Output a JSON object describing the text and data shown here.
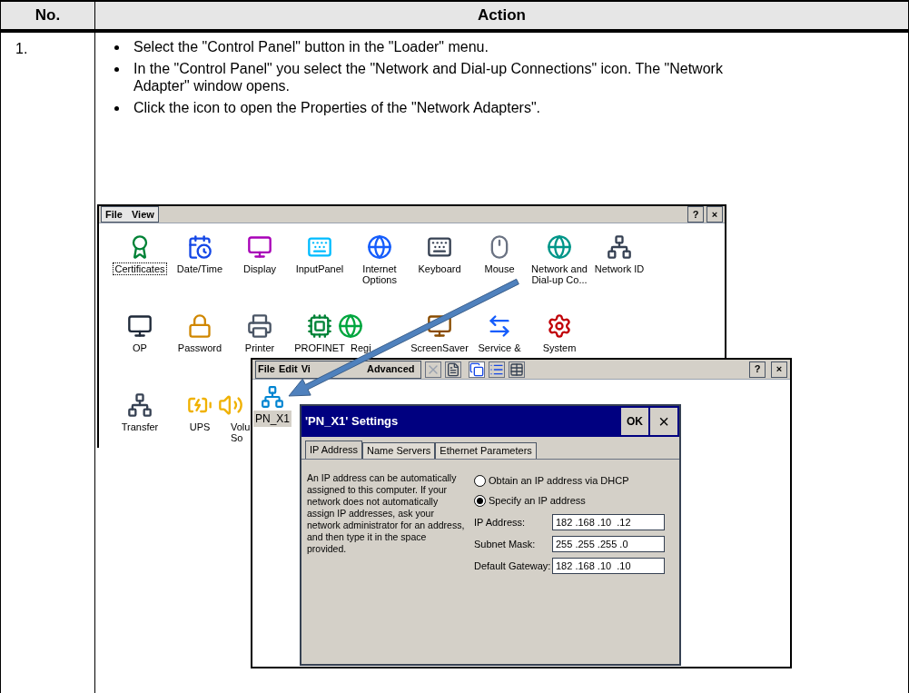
{
  "table": {
    "columns": [
      "No.",
      "Action"
    ],
    "rows": [
      {
        "number": "1.",
        "bullets": [
          "Select the \"Control Panel\" button in the \"Loader\" menu.",
          "In the \"Control Panel\" you select the \"Network and Dial-up Connections\" icon. The \"Network Adapter\" window opens.",
          "Click the icon to open the Properties of the \"Network Adapters\"."
        ],
        "screenshot": {
          "control_panel": {
            "menu": [
              "File",
              "View"
            ],
            "buttons": [
              "?",
              "×"
            ],
            "rows": [
              [
                {
                  "lines": [
                    "Certificates"
                  ],
                  "selected": true,
                  "kind": "full"
                },
                {
                  "lines": [
                    "Date/Time"
                  ],
                  "selected": false,
                  "kind": "full"
                },
                {
                  "lines": [
                    "Display"
                  ],
                  "selected": false,
                  "kind": "full"
                },
                {
                  "lines": [
                    "InputPanel"
                  ],
                  "selected": false,
                  "kind": "full"
                },
                {
                  "lines": [
                    "Internet",
                    "Options"
                  ],
                  "selected": false,
                  "kind": "full"
                },
                {
                  "lines": [
                    "Keyboard"
                  ],
                  "selected": false,
                  "kind": "full"
                },
                {
                  "lines": [
                    "Mouse"
                  ],
                  "selected": false,
                  "kind": "full"
                },
                {
                  "lines": [
                    "Network and",
                    "Dial-up Co..."
                  ],
                  "selected": false,
                  "kind": "full"
                },
                {
                  "lines": [
                    "Network ID"
                  ],
                  "selected": false,
                  "kind": "full"
                }
              ],
              [
                {
                  "lines": [
                    "OP"
                  ],
                  "selected": false,
                  "kind": "full"
                },
                {
                  "lines": [
                    "Password"
                  ],
                  "selected": false,
                  "kind": "full"
                },
                {
                  "lines": [
                    "Printer"
                  ],
                  "selected": false,
                  "kind": "full"
                },
                {
                  "lines": [
                    "PROFINET"
                  ],
                  "selected": false,
                  "kind": "full"
                },
                {
                  "lines": [
                    "Regi"
                  ],
                  "selected": false,
                  "kind": "partial"
                },
                {
                  "lines": [
                    "ScreenSaver"
                  ],
                  "selected": false,
                  "kind": "full"
                },
                {
                  "lines": [
                    "Service &"
                  ],
                  "selected": false,
                  "kind": "full"
                },
                {
                  "lines": [
                    "System"
                  ],
                  "selected": false,
                  "kind": "full"
                }
              ],
              [
                {
                  "lines": [
                    "Transfer"
                  ],
                  "selected": false,
                  "kind": "full"
                },
                {
                  "lines": [
                    "UPS"
                  ],
                  "selected": false,
                  "kind": "full"
                },
                {
                  "lines": [
                    "Volu",
                    "So"
                  ],
                  "selected": false,
                  "kind": "partial"
                }
              ]
            ]
          },
          "network_window": {
            "menu": [
              "File",
              "Edit",
              "Vi",
              "Advanced"
            ],
            "buttons": [
              "?",
              "×"
            ],
            "items": [
              {
                "label": "PN_X1",
                "selected": true
              }
            ],
            "dialog": {
              "title": "'PN_X1' Settings",
              "ok": "OK",
              "close": "×",
              "tabs": [
                {
                  "label": "IP Address",
                  "selected": true
                },
                {
                  "label": "Name Servers",
                  "selected": false
                },
                {
                  "label": "Ethernet Parameters",
                  "selected": false
                }
              ],
              "description": "An IP address can be automatically assigned to this computer.  If your network does not automatically assign IP addresses, ask your network administrator for an address, and then type it in the space provided.",
              "radios": [
                {
                  "label": "Obtain an IP address via DHCP",
                  "selected": false
                },
                {
                  "label": "Specify an IP address",
                  "selected": true
                }
              ],
              "fields": [
                {
                  "label": "IP Address:",
                  "value": "182 .168 .10  .12"
                },
                {
                  "label": "Subnet Mask:",
                  "value": "255 .255 .255 .0"
                },
                {
                  "label": "Default Gateway:",
                  "value": "182 .168 .10  .10"
                }
              ]
            }
          }
        }
      }
    ]
  }
}
